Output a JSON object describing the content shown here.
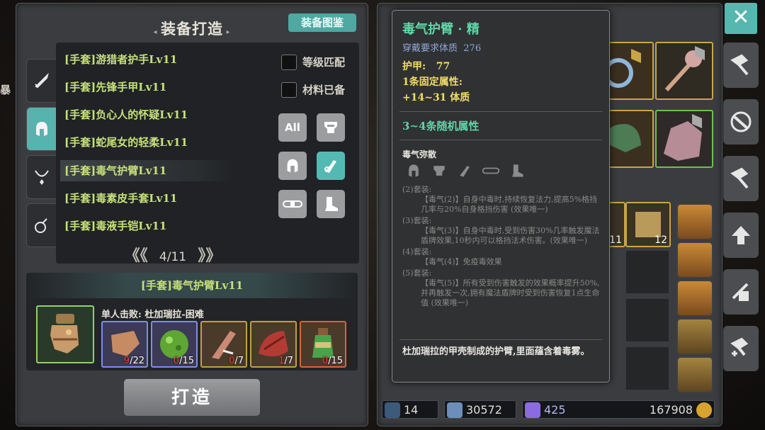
{
  "edge_text": "暴",
  "craft": {
    "title": "装备打造",
    "atlas_button": "装备图鉴",
    "side_tabs": [
      "sword-icon",
      "helmet-icon",
      "necklace-icon",
      "potion-icon"
    ],
    "items": [
      "[手套]游猎者护手Lv11",
      "[手套]先锋手甲Lv11",
      "[手套]负心人的怀疑Lv11",
      "[手套]蛇尾女的轻柔Lv11",
      "[手套]毒气护臂Lv11",
      "[手套]毒素皮手套Lv11",
      "[手套]毒液手铠Lv11"
    ],
    "selected_index": 4,
    "level_match": "等级匹配",
    "materials_ready": "材料已备",
    "filter_all": "All",
    "pager": "4/11",
    "pager_prev": "《《",
    "pager_next": "》》",
    "detail": {
      "title": "[手套]毒气护臂Lv11",
      "requirement": "单人击败: 杜加瑞拉-困难",
      "materials": [
        {
          "have": "9",
          "need": "/22",
          "rarity": "blue",
          "color": "#7d8cf0"
        },
        {
          "have": "0",
          "need": "/15",
          "rarity": "blue",
          "color": "#7d8cf0"
        },
        {
          "have": "0",
          "need": "/7",
          "rarity": "gold",
          "color": "#c1a045"
        },
        {
          "have": "1",
          "need": "/7",
          "rarity": "gold",
          "color": "#c1a045"
        },
        {
          "have": "0",
          "need": "/15",
          "rarity": "red",
          "color": "#d7653b"
        }
      ]
    },
    "forge_button": "打造"
  },
  "tooltip": {
    "name": "毒气护臂 · 精",
    "req_label": "穿戴要求体质",
    "req_value": "276",
    "armor_label": "护甲:",
    "armor_value": "77",
    "fixed_attr_label": "1条固定属性:",
    "fixed_attr_value": "+14~31 体质",
    "random_attr": "3~4条随机属性",
    "set_name": "毒气弥散",
    "set_bonus": [
      {
        "label": "(2)套装:",
        "text": "【毒气(2)】自身中毒时,持续恢复法力,提高5%格挡几率与20%自身格挡伤害 (效果唯一)"
      },
      {
        "label": "(3)套装:",
        "text": "【毒气(3)】自身中毒时,受到伤害30%几率触发魔法盾牌效果,10秒内可以格挡法术伤害。(效果唯一)"
      },
      {
        "label": "(4)套装:",
        "text": "【毒气(4)】免疫毒效果"
      },
      {
        "label": "(5)套装:",
        "text": "【毒气(5)】所有受到伤害触发的效果概率提升50%,并再触发一次,拥有魔法盾牌时受到伤害恢复1点生命值 (效果唯一)"
      }
    ],
    "description": "杜加瑞拉的甲壳制成的护臂,里面蕴含着毒雾。"
  },
  "inventory": {
    "counts": [
      "11",
      "12"
    ],
    "resources": [
      {
        "icon": "wand-icon",
        "value": "14"
      },
      {
        "icon": "crystal-icon",
        "value": "30572"
      },
      {
        "icon": "purple-gem-icon",
        "value": "425"
      },
      {
        "icon": "gold-coin-icon",
        "value": "167908"
      }
    ]
  },
  "toolbar": {
    "close": "✕",
    "tools": [
      "forge-hammer-icon",
      "disassemble-icon",
      "smith-icon",
      "upgrade-icon",
      "reforge-icon",
      "enchant-icon"
    ]
  }
}
